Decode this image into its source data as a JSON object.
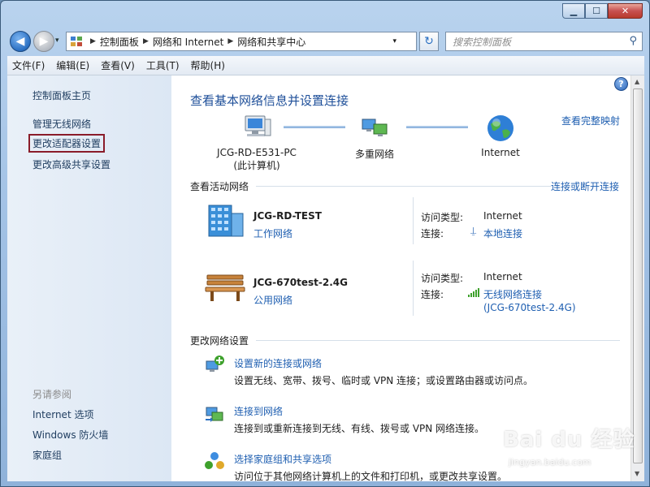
{
  "window": {
    "minimize_glyph": "▁",
    "maximize_glyph": "☐",
    "close_glyph": "✕"
  },
  "address_bar": {
    "crumbs": [
      "控制面板",
      "网络和 Internet",
      "网络和共享中心"
    ],
    "search_placeholder": "搜索控制面板"
  },
  "menu": [
    "文件(F)",
    "编辑(E)",
    "查看(V)",
    "工具(T)",
    "帮助(H)"
  ],
  "sidebar": {
    "links": [
      "控制面板主页",
      "管理无线网络",
      "更改适配器设置",
      "更改高级共享设置"
    ],
    "highlighted_index": 2,
    "see_also_heading": "另请参阅",
    "see_also": [
      "Internet 选项",
      "Windows 防火墙",
      "家庭组"
    ]
  },
  "main": {
    "title": "查看基本网络信息并设置连接",
    "full_map_link": "查看完整映射",
    "map_nodes": {
      "pc_name": "JCG-RD-E531-PC",
      "pc_sub": "(此计算机)",
      "multi": "多重网络",
      "internet": "Internet"
    },
    "active_networks": {
      "heading": "查看活动网络",
      "connect_link": "连接或断开连接",
      "networks": [
        {
          "name": "JCG-RD-TEST",
          "type": "工作网络",
          "access_label": "访问类型:",
          "access_value": "Internet",
          "conn_label": "连接:",
          "conn_value": "本地连接",
          "conn_value2": ""
        },
        {
          "name": "JCG-670test-2.4G",
          "type": "公用网络",
          "access_label": "访问类型:",
          "access_value": "Internet",
          "conn_label": "连接:",
          "conn_value": "无线网络连接",
          "conn_value2": "(JCG-670test-2.4G)"
        }
      ]
    },
    "change_settings": {
      "heading": "更改网络设置",
      "tasks": [
        {
          "title": "设置新的连接或网络",
          "desc": "设置无线、宽带、拨号、临时或 VPN 连接；或设置路由器或访问点。"
        },
        {
          "title": "连接到网络",
          "desc": "连接到或重新连接到无线、有线、拨号或 VPN 网络连接。"
        },
        {
          "title": "选择家庭组和共享选项",
          "desc": "访问位于其他网络计算机上的文件和打印机，或更改共享设置。"
        }
      ]
    }
  },
  "watermark": {
    "main": "Bai du 经验",
    "sub": "jingyan.baidu.com"
  }
}
